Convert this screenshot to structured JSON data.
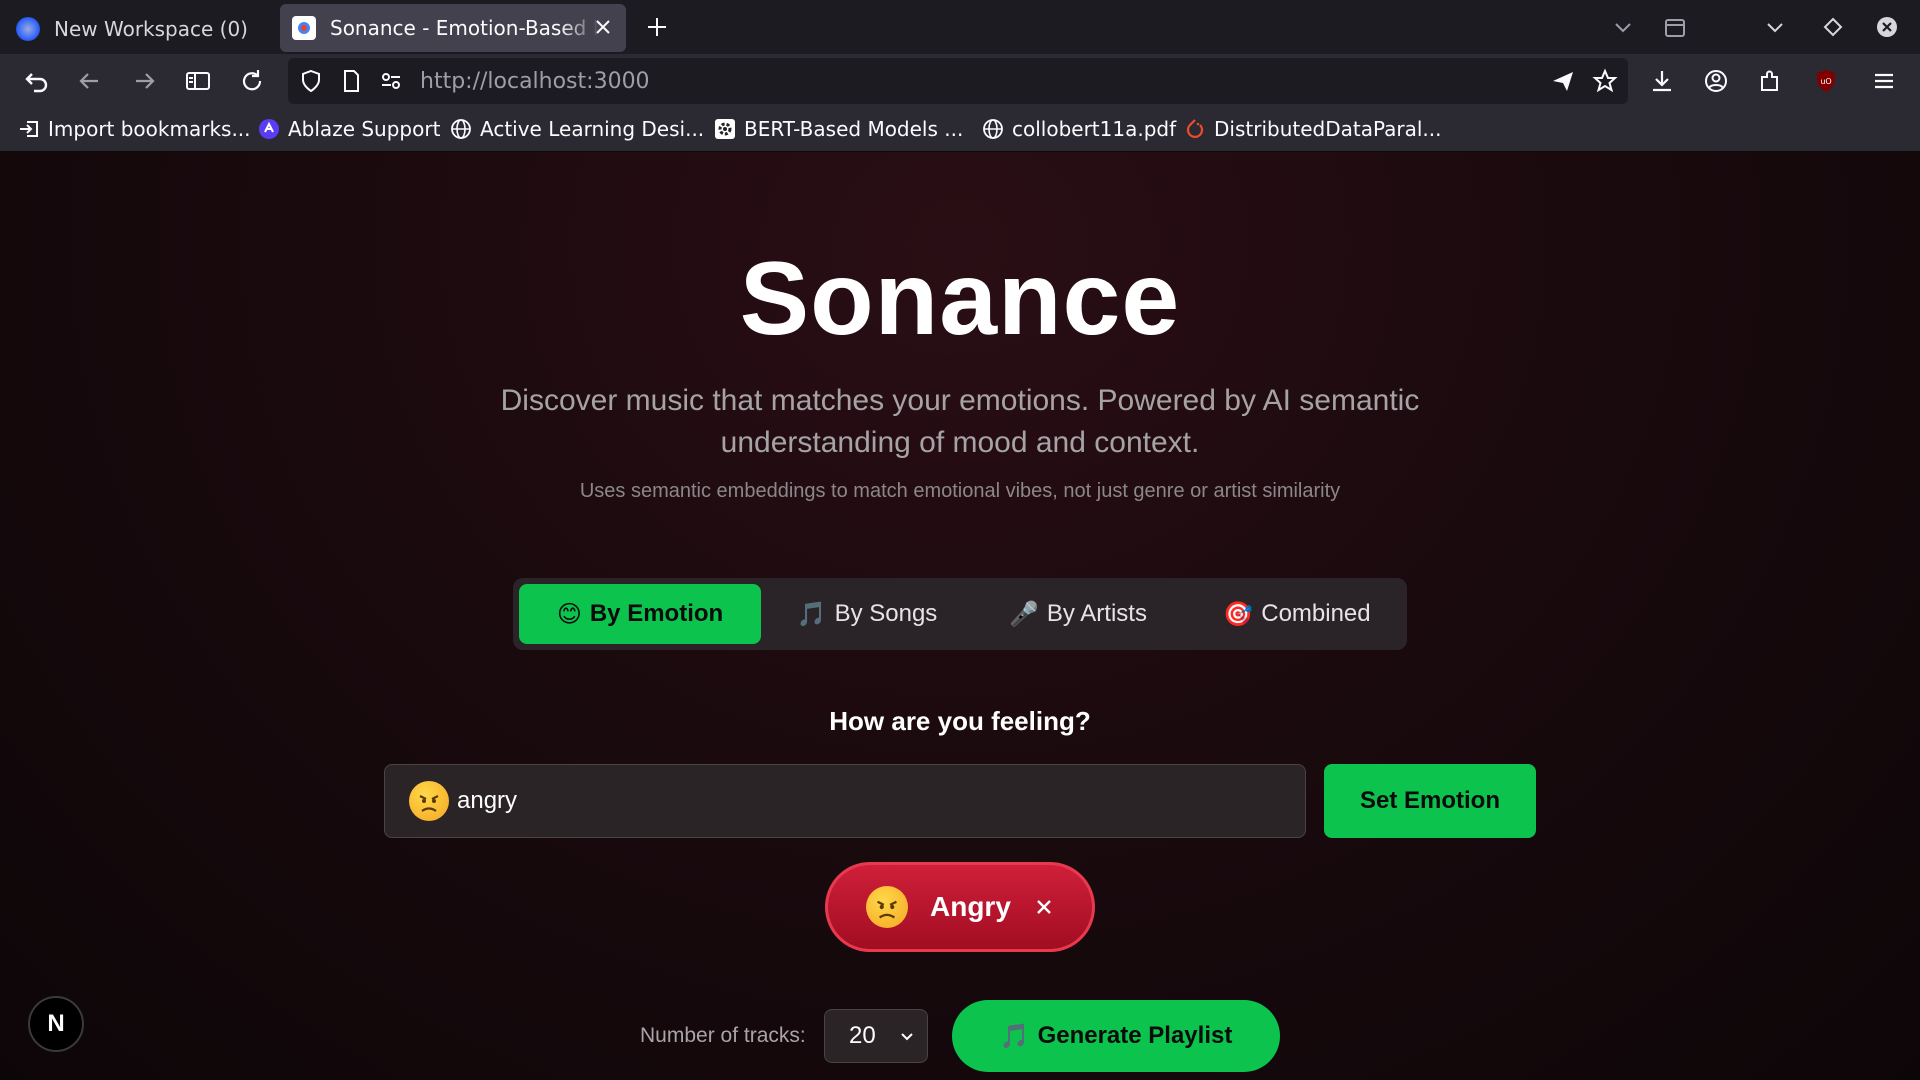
{
  "browser": {
    "tabs": [
      {
        "title": "New Workspace (0)",
        "active": false
      },
      {
        "title": "Sonance - Emotion-Based Music",
        "active": true
      }
    ],
    "url": {
      "host": "http://localhost",
      "port": ":3000"
    },
    "bookmarks": [
      {
        "label": "Import bookmarks...",
        "icon": "import-icon"
      },
      {
        "label": "Ablaze Support",
        "icon": "ablaze-icon"
      },
      {
        "label": "Active Learning Desi...",
        "icon": "globe-icon"
      },
      {
        "label": "BERT-Based Models ...",
        "icon": "gear-icon"
      },
      {
        "label": "collobert11a.pdf",
        "icon": "globe-icon"
      },
      {
        "label": "DistributedDataParal...",
        "icon": "pytorch-icon"
      }
    ]
  },
  "app": {
    "brand": "Sonance",
    "subtitle": "Discover music that matches your emotions. Powered by AI semantic understanding of mood and context.",
    "note": "Uses semantic embeddings to match emotional vibes, not just genre or artist similarity",
    "modes": [
      {
        "emoji": "😊",
        "label": "By Emotion",
        "active": true
      },
      {
        "emoji": "🎵",
        "label": "By Songs",
        "active": false
      },
      {
        "emoji": "🎤",
        "label": "By Artists",
        "active": false
      },
      {
        "emoji": "🎯",
        "label": "Combined",
        "active": false
      }
    ],
    "question": "How are you feeling?",
    "input_value": "angry",
    "set_button": "Set Emotion",
    "selected_emotion": "Angry",
    "tracks_label": "Number of tracks:",
    "tracks_value": "20",
    "generate_button": "Generate Playlist",
    "next_badge": "N"
  },
  "colors": {
    "accent_green": "#0cc44d",
    "emotion_red": "#d01f3a"
  }
}
